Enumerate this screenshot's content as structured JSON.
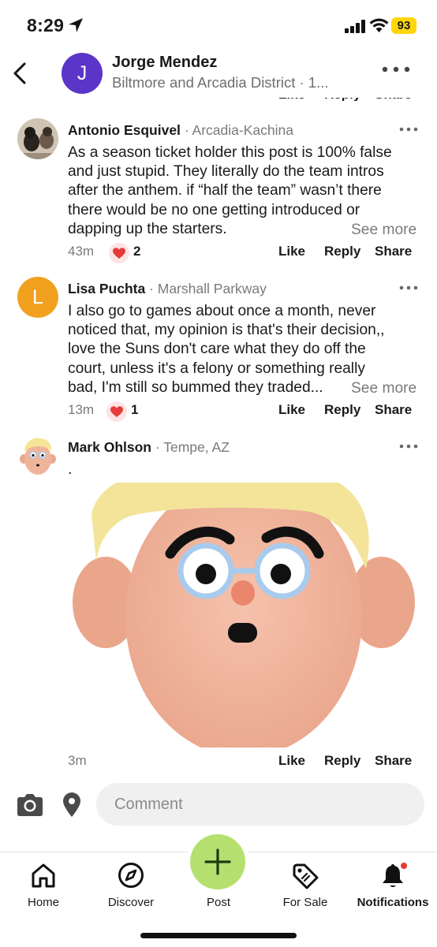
{
  "status": {
    "time": "8:29",
    "battery": "93"
  },
  "header": {
    "avatar_letter": "J",
    "name": "Jorge Mendez",
    "subtitle": "Biltmore and Arcadia District · 1..."
  },
  "comments": [
    {
      "author": "Antonio Esquivel",
      "location": "· Arcadia-Kachina",
      "text": "As a season ticket holder this post is 100% false\nand just stupid. They literally do the team intros\nafter the anthem. if “half the team” wasn’t there\nthere would be no one getting introduced or\ndapping up the starters.",
      "see_more": "See more",
      "time": "43m",
      "reactions": "2",
      "like": "Like",
      "reply": "Reply",
      "share": "Share"
    },
    {
      "author": "Lisa Puchta",
      "avatar_letter": "L",
      "location": "· Marshall Parkway",
      "text": "I also go to games about once a month, never\nnoticed that, my opinion is that's their decision,,\nlove the Suns don't care what they do off the\ncourt, unless it's a felony or something really\nbad, I'm still so bummed they traded...",
      "see_more": "See more",
      "time": "13m",
      "reactions": "1",
      "like": "Like",
      "reply": "Reply",
      "share": "Share"
    },
    {
      "author": "Mark Ohlson",
      "location": "· Tempe, AZ",
      "text": ".",
      "time": "3m",
      "like": "Like",
      "reply": "Reply",
      "share": "Share"
    }
  ],
  "comment_box": {
    "placeholder": "Comment"
  },
  "nav": {
    "items": [
      {
        "label": "Home",
        "icon": "home-icon"
      },
      {
        "label": "Discover",
        "icon": "compass-icon"
      },
      {
        "label": "Post",
        "icon": "plus-icon"
      },
      {
        "label": "For Sale",
        "icon": "price-tag-icon"
      },
      {
        "label": "Notifications",
        "icon": "bell-icon"
      }
    ]
  },
  "colors": {
    "header_avatar": "#5b35c8",
    "lisa_avatar": "#f2a11f",
    "post_button": "#b5e06f",
    "heart": "#e63b3b",
    "battery": "#ffd60a"
  }
}
